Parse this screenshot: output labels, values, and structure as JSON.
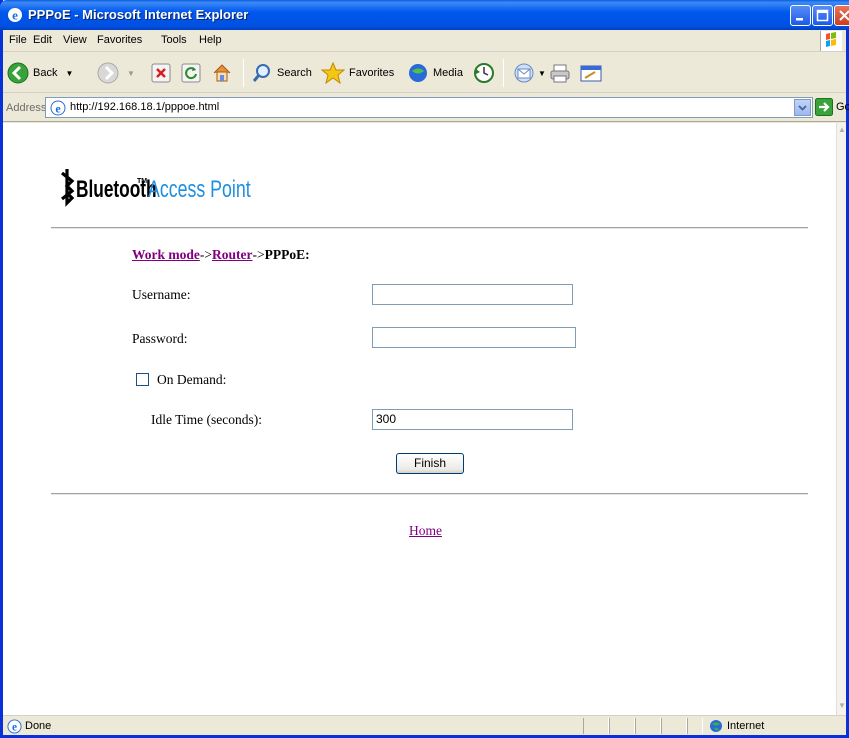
{
  "window": {
    "title": "PPPoE - Microsoft Internet Explorer"
  },
  "menu": {
    "file": "File",
    "edit": "Edit",
    "view": "View",
    "favorites": "Favorites",
    "tools": "Tools",
    "help": "Help"
  },
  "toolbar": {
    "back": "Back",
    "search": "Search",
    "favorites": "Favorites",
    "media": "Media"
  },
  "address": {
    "label": "Address",
    "url": "http://192.168.18.1/pppoe.html",
    "go": "Go"
  },
  "page": {
    "logo": {
      "brand": "Bluetooth",
      "tm": "TM",
      "product": "Access Point"
    },
    "breadcrumb": {
      "work_mode": "Work mode",
      "sep1": "->",
      "router": "Router",
      "sep2": "->",
      "current": "PPPoE:"
    },
    "username_label": "Username:",
    "username_value": "",
    "password_label": "Password:",
    "password_value": "",
    "on_demand_label": "On Demand:",
    "on_demand_checked": false,
    "idle_label": "Idle Time (seconds):",
    "idle_value": "300",
    "finish_label": "Finish",
    "home_link": "Home"
  },
  "status": {
    "text": "Done",
    "zone": "Internet"
  },
  "colors": {
    "titlebar": "#0058ee",
    "link_visited": "#800080",
    "logo_blue": "#1e8fe0"
  }
}
